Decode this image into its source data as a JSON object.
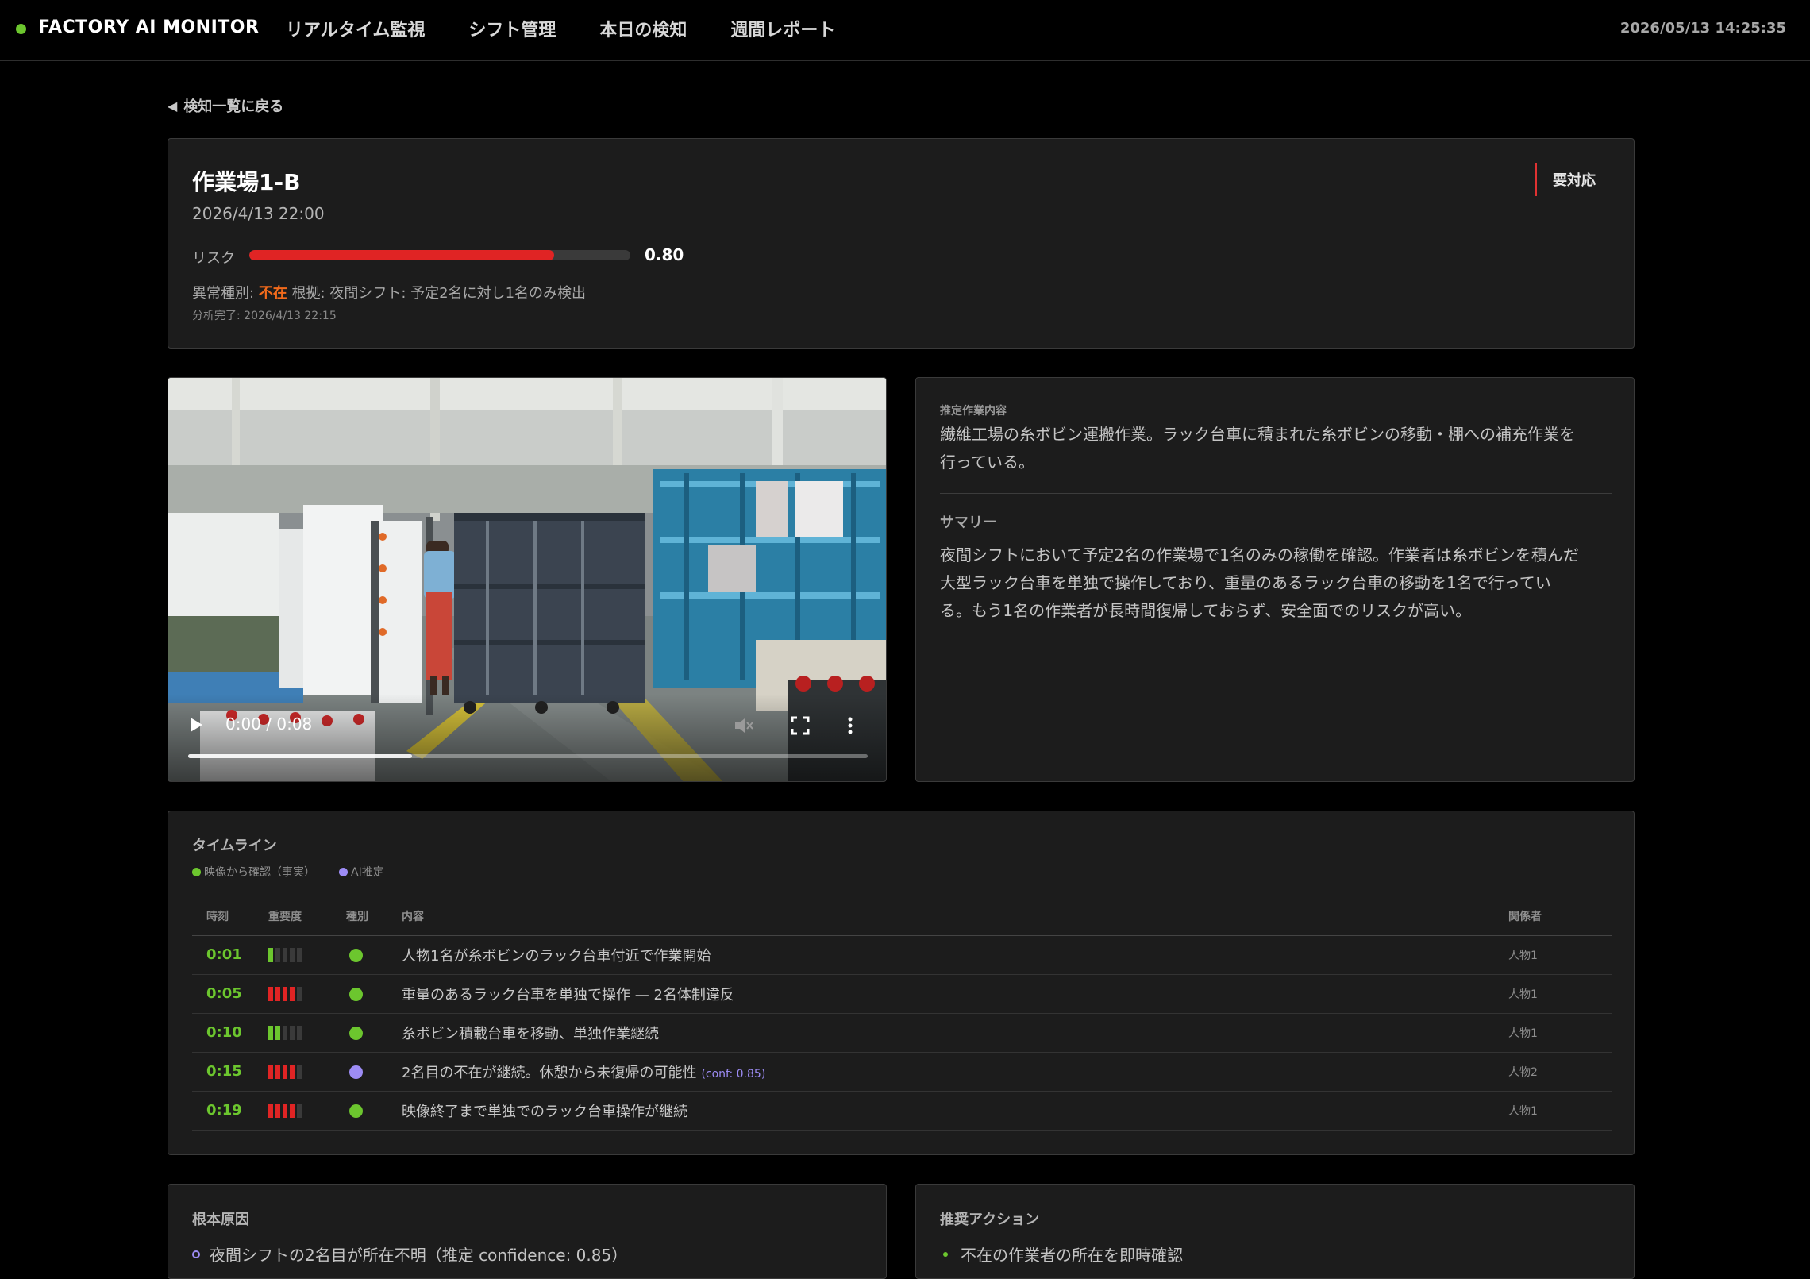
{
  "app": {
    "brand": "FACTORY AI MONITOR",
    "clock": "2026/05/13 14:25:35",
    "brand_color": "#6cc62e"
  },
  "nav": {
    "items": [
      "リアルタイム監視",
      "シフト管理",
      "本日の検知",
      "週間レポート"
    ]
  },
  "back": {
    "label": "検知一覧に戻る"
  },
  "incident": {
    "title": "作業場1-B",
    "date": "2026/4/13 22:00",
    "badge": "要対応",
    "risk_label": "リスク",
    "risk_value": "0.80",
    "risk_fraction": 0.8,
    "anomaly_prefix": "異常種別:",
    "anomaly_type": "不在",
    "anomaly_basis": "根拠: 夜間シフト: 予定2名に対し1名のみ検出",
    "analyzed": "分析完了: 2026/4/13 22:15"
  },
  "video": {
    "time": "0:00 / 0:08",
    "buffered_fraction": 0.33
  },
  "info": {
    "task_label": "推定作業内容",
    "task_lines": [
      "繊維工場の糸ボビン運搬作業。ラック台車に積まれた糸ボビンの移動・棚への補充作業を",
      "行っている。"
    ],
    "summary_label": "サマリー",
    "summary_lines": [
      "夜間シフトにおいて予定2名の作業場で1名のみの稼働を確認。作業者は糸ボビンを積んだ",
      "大型ラック台車を単独で操作しており、重量のあるラック台車の移動を1名で行ってい",
      "る。もう1名の作業者が長時間復帰しておらず、安全面でのリスクが高い。"
    ]
  },
  "timeline": {
    "title": "タイムライン",
    "legend": [
      {
        "label": "映像から確認（事実）",
        "color": "#6cc62e"
      },
      {
        "label": "AI推定",
        "color": "#9d8cf5"
      }
    ],
    "columns": {
      "time": "時刻",
      "severity": "重要度",
      "kind": "種別",
      "content": "内容",
      "who": "関係者"
    },
    "rows": [
      {
        "time": "0:01",
        "severity": 1,
        "kind": "fact",
        "content": "人物1名が糸ボビンのラック台車付近で作業開始",
        "conf": "",
        "who": "人物1"
      },
      {
        "time": "0:05",
        "severity": 4,
        "kind": "fact",
        "content": "重量のあるラック台車を単独で操作 — 2名体制違反",
        "conf": "",
        "who": "人物1"
      },
      {
        "time": "0:10",
        "severity": 2,
        "kind": "fact",
        "content": "糸ボビン積載台車を移動、単独作業継続",
        "conf": "",
        "who": "人物1"
      },
      {
        "time": "0:15",
        "severity": 4,
        "kind": "ai",
        "content": "2名目の不在が継続。休憩から未復帰の可能性",
        "conf": "(conf: 0.85)",
        "who": "人物2"
      },
      {
        "time": "0:19",
        "severity": 4,
        "kind": "fact",
        "content": "映像終了まで単独でのラック台車操作が継続",
        "conf": "",
        "who": "人物1"
      }
    ],
    "colors": {
      "fact": "#6cc62e",
      "ai": "#9d8cf5",
      "sev_low": "#6cc62e",
      "sev_high": "#e02424",
      "sev_off": "#3a3a3a"
    }
  },
  "root_cause": {
    "title": "根本原因",
    "items": [
      "夜間シフトの2名目が所在不明（推定 confidence: 0.85）"
    ]
  },
  "actions": {
    "title": "推奨アクション",
    "items": [
      "不在の作業者の所在を即時確認"
    ]
  }
}
